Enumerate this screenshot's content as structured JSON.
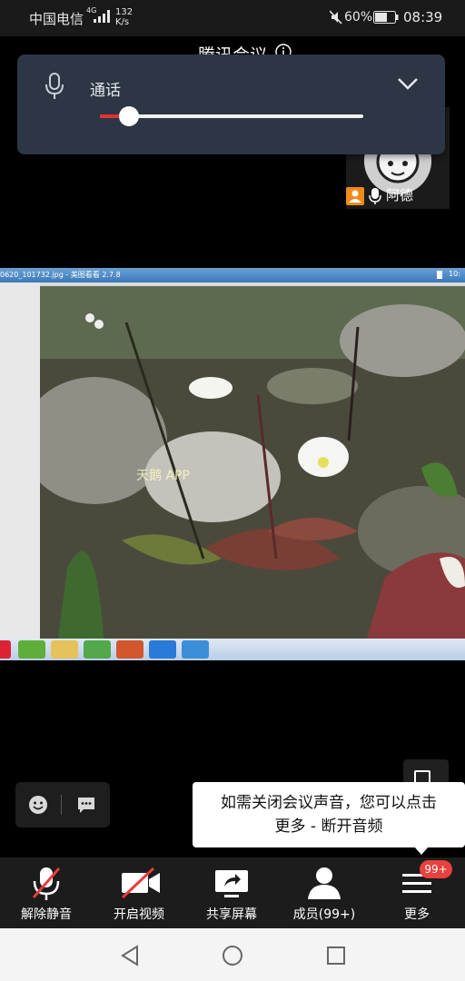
{
  "status_bar": {
    "carrier": "中国电信",
    "network_badge": "4G",
    "net_speed_value": "132",
    "net_speed_unit": "K/s",
    "battery": "60%",
    "time": "08:39"
  },
  "meeting": {
    "title": "腾讯会议"
  },
  "audio_panel": {
    "label": "通话",
    "volume_level_fraction": 0.11,
    "accent_color": "#e33333"
  },
  "participant": {
    "name": "阿德",
    "host_badge_color": "#f08a1c"
  },
  "shared_screen": {
    "window_title": "0620_101732.jpg - 美图看看 2.7.8",
    "clock": "10:",
    "watermark": "天鹅 APP",
    "taskbar_icons": [
      "start-icon",
      "wechat-icon",
      "file-manager-icon",
      "ie-browser-icon",
      "powerpoint-icon",
      "tencent-meeting-icon",
      "ie-icon"
    ]
  },
  "tooltip": {
    "line1": "如需关闭会议声音，您可以点击",
    "line2": "更多 - 断开音频"
  },
  "toolbar": {
    "unmute": "解除静音",
    "start_video": "开启视频",
    "share_screen": "共享屏幕",
    "members": "成员(99+)",
    "more": "更多",
    "more_badge": "99+",
    "badge_color": "#e9413e"
  },
  "icons": {
    "status": [
      "signal-icon",
      "mute-icon",
      "battery-icon"
    ],
    "quick_bar": [
      "emoji-icon",
      "chat-icon"
    ],
    "nav": [
      "back-icon",
      "home-icon",
      "recents-icon"
    ]
  }
}
